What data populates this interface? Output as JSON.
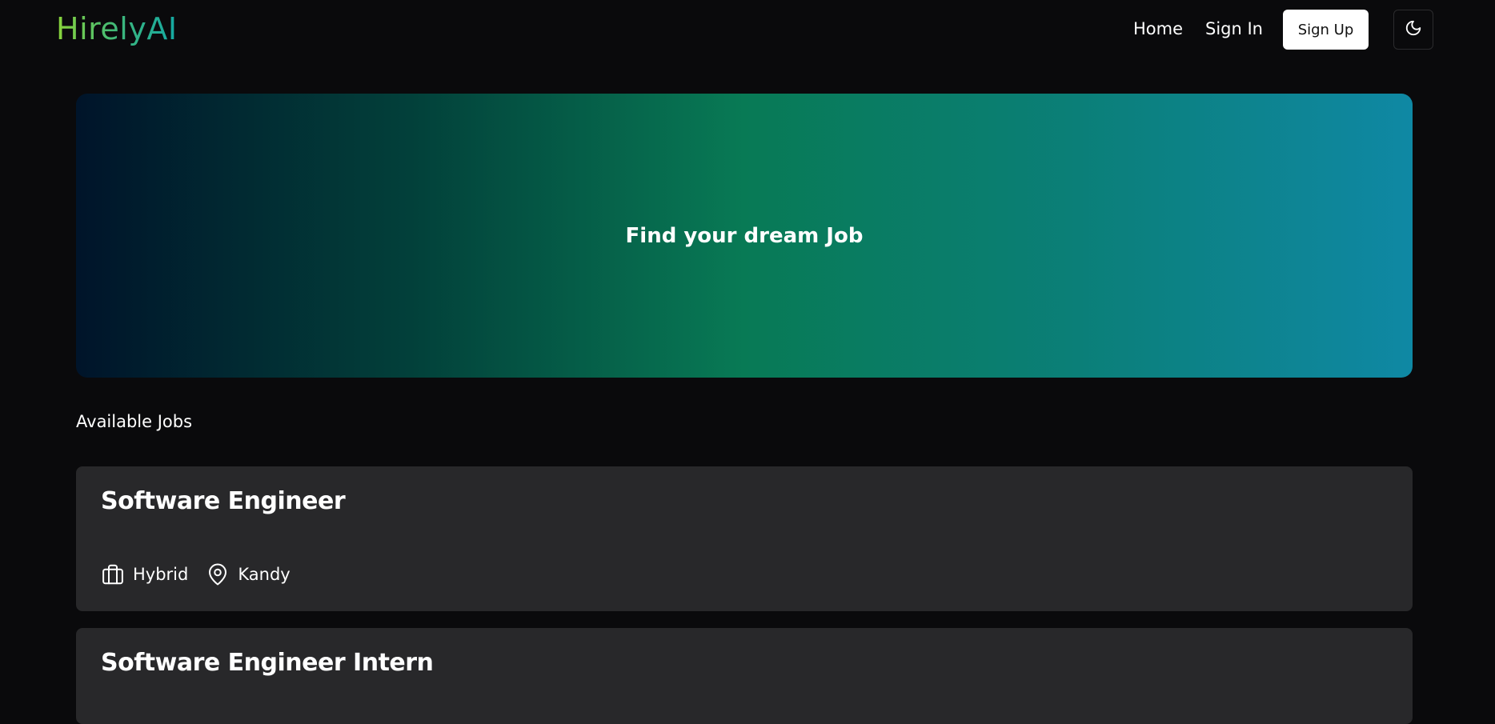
{
  "brand": {
    "name": "HirelyAI",
    "gradient": [
      "#8ad43a",
      "#3fb87a",
      "#13a8a4"
    ]
  },
  "nav": {
    "home": "Home",
    "sign_in": "Sign In",
    "sign_up": "Sign Up",
    "theme_toggle_icon": "moon-icon"
  },
  "hero": {
    "title": "Find your dream Job",
    "gradient": [
      "#00142a",
      "#02403a",
      "#087a55",
      "#0b7f78",
      "#0f88a4"
    ]
  },
  "jobs": {
    "section_title": "Available Jobs",
    "items": [
      {
        "title": "Software Engineer",
        "type": "Hybrid",
        "type_icon": "briefcase-icon",
        "location": "Kandy",
        "location_icon": "map-pin-icon"
      },
      {
        "title": "Software Engineer Intern"
      }
    ]
  },
  "colors": {
    "background": "#0a0a0c",
    "card": "#28282a",
    "text": "#ffffff"
  }
}
